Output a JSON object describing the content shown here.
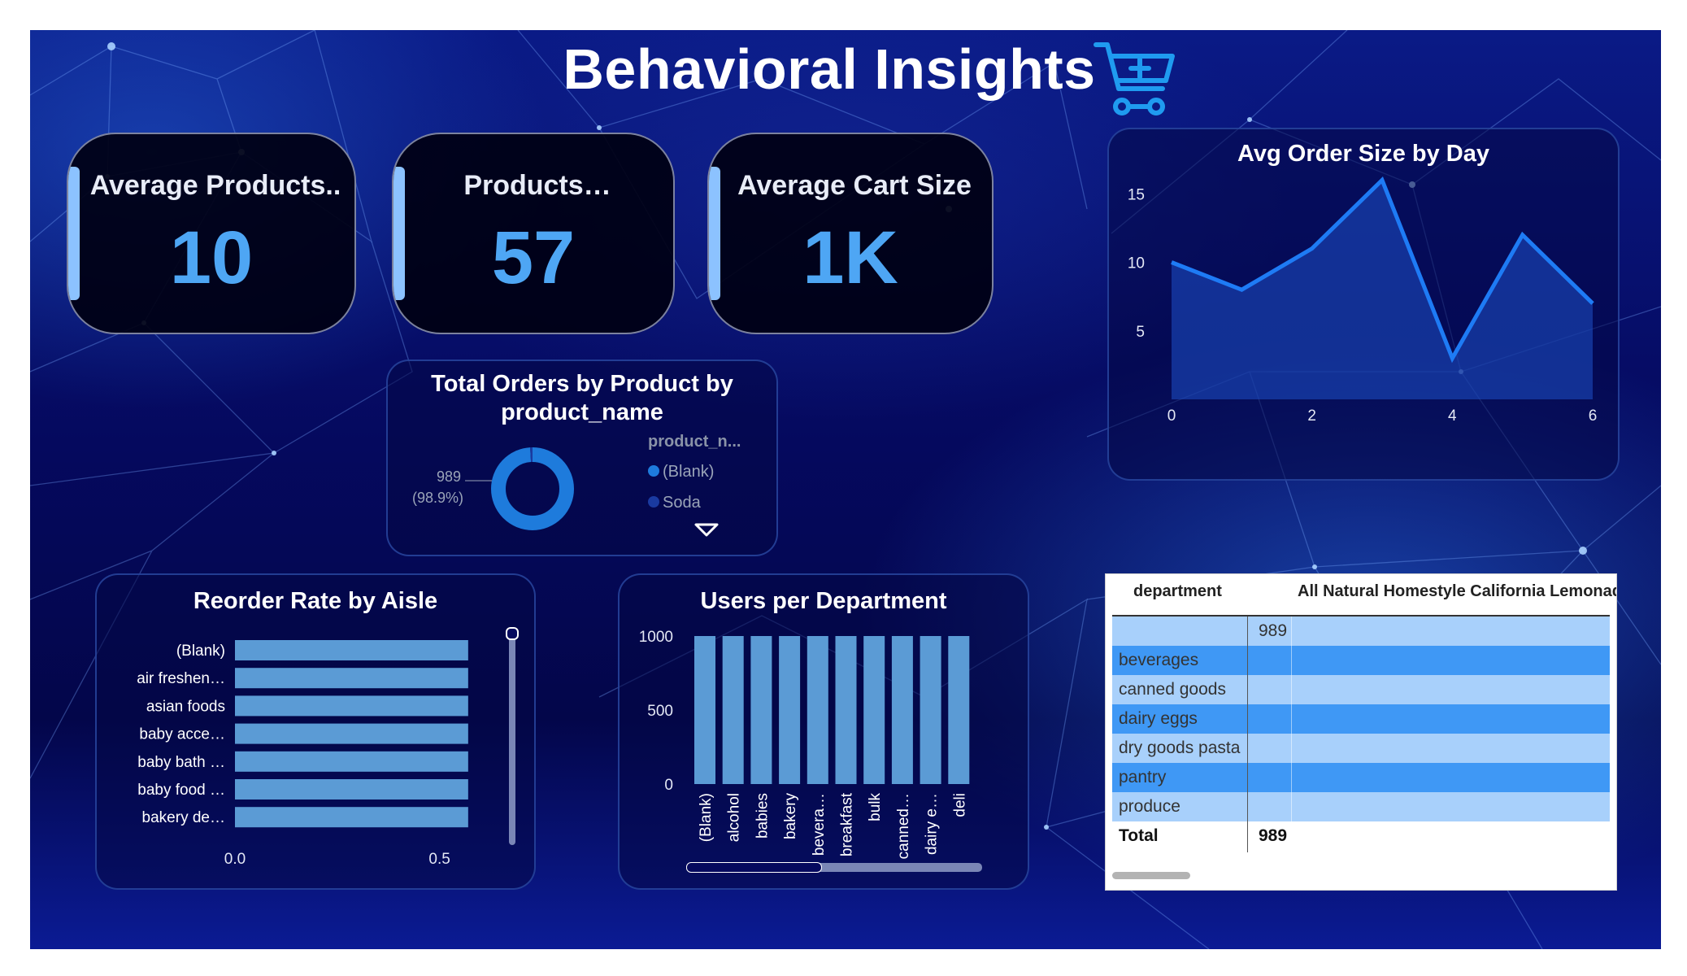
{
  "title": "Behavioral Insights",
  "colors": {
    "accent": "#4ea6f4",
    "bar": "#5b9bd5",
    "line": "#1e7bf5",
    "donut": "#1e7bdc"
  },
  "icons": {
    "cart": "cart-plus-icon",
    "chevron": "chevron-down-icon"
  },
  "kpis": [
    {
      "label": "Average Products..",
      "value": "10"
    },
    {
      "label": "Products…",
      "value": "57"
    },
    {
      "label": "Average Cart Size",
      "value": "1K"
    }
  ],
  "donut": {
    "title_line1": "Total Orders by Product by",
    "title_line2": "product_name",
    "value_label": "989",
    "pct_label": "(98.9%)",
    "legend_title": "product_n...",
    "legend": [
      "(Blank)",
      "Soda"
    ],
    "legend_colors": [
      "#1e7bdc",
      "#1a3aa0"
    ]
  },
  "reorder": {
    "title": "Reorder Rate by Aisle"
  },
  "users": {
    "title": "Users per Department"
  },
  "avg_order": {
    "title": "Avg Order Size by Day"
  },
  "matrix": {
    "header_col1": "department",
    "header_col2": "All Natural Homestyle California Lemonade",
    "rows": [
      {
        "dept": "",
        "val": "989"
      },
      {
        "dept": "beverages",
        "val": ""
      },
      {
        "dept": "canned goods",
        "val": ""
      },
      {
        "dept": "dairy eggs",
        "val": ""
      },
      {
        "dept": "dry goods pasta",
        "val": ""
      },
      {
        "dept": "pantry",
        "val": ""
      },
      {
        "dept": "produce",
        "val": ""
      }
    ],
    "total_label": "Total",
    "total_value": "989"
  },
  "chart_data": [
    {
      "type": "bar",
      "orientation": "horizontal",
      "title": "Reorder Rate by Aisle",
      "categories": [
        "(Blank)",
        "air freshen…",
        "asian foods",
        "baby acce…",
        "baby bath …",
        "baby food …",
        "bakery de…"
      ],
      "values": [
        0.57,
        0.57,
        0.57,
        0.57,
        0.57,
        0.57,
        0.57
      ],
      "xticks": [
        "0.0",
        "0.5"
      ],
      "xlim": [
        0,
        0.62
      ],
      "grid": false
    },
    {
      "type": "bar",
      "title": "Users per Department",
      "categories": [
        "(Blank)",
        "alcohol",
        "babies",
        "bakery",
        "bevera…",
        "breakfast",
        "bulk",
        "canned…",
        "dairy e…",
        "deli"
      ],
      "values": [
        1000,
        1000,
        1000,
        1000,
        1000,
        1000,
        1000,
        1000,
        1000,
        1000
      ],
      "yticks": [
        "0",
        "500",
        "1000"
      ],
      "ylim": [
        0,
        1000
      ],
      "grid": false
    },
    {
      "type": "area",
      "title": "Avg Order Size by Day",
      "x": [
        0,
        1,
        2,
        3,
        4,
        5,
        6
      ],
      "y": [
        10,
        8,
        11,
        16,
        3,
        12,
        7
      ],
      "xticks": [
        "0",
        "2",
        "4",
        "6"
      ],
      "yticks": [
        "5",
        "10",
        "15"
      ],
      "xlim": [
        0,
        6
      ],
      "ylim": [
        0,
        16.5
      ],
      "grid": false
    },
    {
      "type": "pie",
      "title": "Total Orders by Product by product_name",
      "labels": [
        "(Blank)",
        "Soda"
      ],
      "values": [
        989,
        11
      ]
    }
  ]
}
